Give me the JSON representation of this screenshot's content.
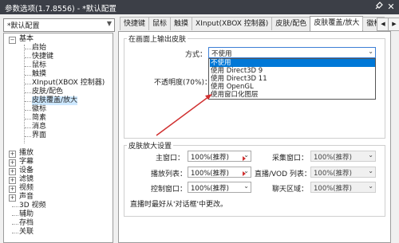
{
  "window": {
    "title": "参数选项(1.7.8556) - *默认配置",
    "pin_icon": "pin-icon",
    "close_label": "✕"
  },
  "preset": {
    "value": "*默认配置"
  },
  "tabs": [
    {
      "label": "快捷键"
    },
    {
      "label": "鼠标"
    },
    {
      "label": "触摸"
    },
    {
      "label": "XInput(XBOX 控制器)"
    },
    {
      "label": "皮肤/配色"
    },
    {
      "label": "皮肤覆盖/放大",
      "active": true
    },
    {
      "label": "徽标"
    }
  ],
  "tree": {
    "basic": "基本",
    "basic_children": [
      "启始",
      "快捷键",
      "鼠标",
      "触摸",
      "XInput(XBOX 控制器)",
      "皮肤/配色",
      "皮肤覆盖/放大",
      "徽标",
      "简素",
      "消息",
      "界面"
    ],
    "top_level": [
      "播放",
      "字幕",
      "设备",
      "滤镜",
      "视频",
      "声音",
      "3D 视频",
      "辅助",
      "存档",
      "关联"
    ]
  },
  "overlay": {
    "group_title": "在画面上输出皮肤",
    "method_label": "方式：",
    "method_value": "不使用",
    "opacity_label": "不透明度(70%)：",
    "options": [
      "不使用",
      "使用 Direct3D 9",
      "使用 Direct3D 11",
      "使用 OpenGL",
      "使用窗口化图层"
    ]
  },
  "zoom": {
    "group_title": "皮肤放大设置",
    "main_window_label": "主窗口：",
    "main_window_value": "100%(推荐)",
    "capture_window_label": "采集窗口：",
    "capture_window_value": "100%(推荐)",
    "playlist_label": "播放列表：",
    "playlist_value": "100%(推荐)",
    "live_vod_label": "直播/VOD 列表：",
    "live_vod_value": "100%(推荐)",
    "control_window_label": "控制窗口：",
    "control_window_value": "100%(推荐)",
    "chat_label": "聊天区域：",
    "chat_value": "100%(推荐)",
    "note": "直播时最好从'对话框'中更改。"
  },
  "colors": {
    "titlebar": "#3c3f47",
    "selection": "#0078d7",
    "annotation_arrow": "#d03030"
  }
}
